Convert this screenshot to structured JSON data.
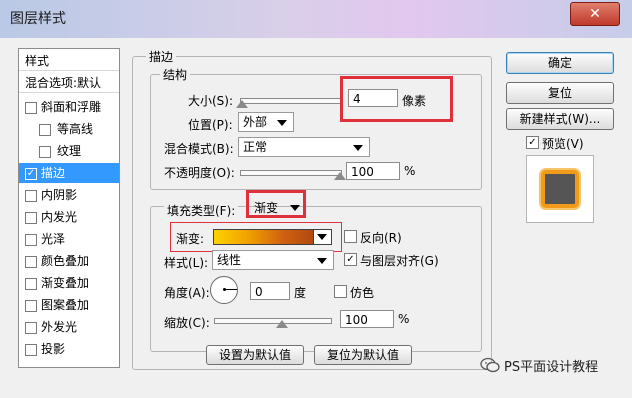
{
  "window": {
    "title": "图层样式",
    "close_glyph": "✕"
  },
  "styles_list": {
    "header": "样式",
    "items": [
      {
        "label": "混合选项:默认",
        "has_checkbox": false,
        "checked": false,
        "selected": false
      },
      {
        "label": "斜面和浮雕",
        "has_checkbox": true,
        "checked": false,
        "selected": false
      },
      {
        "label": "等高线",
        "has_checkbox": true,
        "checked": false,
        "selected": false
      },
      {
        "label": "纹理",
        "has_checkbox": true,
        "checked": false,
        "selected": false
      },
      {
        "label": "描边",
        "has_checkbox": true,
        "checked": true,
        "selected": true
      },
      {
        "label": "内阴影",
        "has_checkbox": true,
        "checked": false,
        "selected": false
      },
      {
        "label": "内发光",
        "has_checkbox": true,
        "checked": false,
        "selected": false
      },
      {
        "label": "光泽",
        "has_checkbox": true,
        "checked": false,
        "selected": false
      },
      {
        "label": "颜色叠加",
        "has_checkbox": true,
        "checked": false,
        "selected": false
      },
      {
        "label": "渐变叠加",
        "has_checkbox": true,
        "checked": false,
        "selected": false
      },
      {
        "label": "图案叠加",
        "has_checkbox": true,
        "checked": false,
        "selected": false
      },
      {
        "label": "外发光",
        "has_checkbox": true,
        "checked": false,
        "selected": false
      },
      {
        "label": "投影",
        "has_checkbox": true,
        "checked": false,
        "selected": false
      }
    ]
  },
  "stroke": {
    "section_title": "描边",
    "structure_title": "结构",
    "size_label": "大小(S):",
    "size_value": "4",
    "size_unit": "像素",
    "position_label": "位置(P):",
    "position_value": "外部",
    "blend_label": "混合模式(B):",
    "blend_value": "正常",
    "opacity_label": "不透明度(O):",
    "opacity_value": "100",
    "opacity_unit": "%",
    "fill_type_label": "填充类型(F):",
    "fill_type_value": "渐变",
    "gradient_label": "渐变:",
    "reverse_label": "反向(R)",
    "style_label": "样式(L):",
    "style_value": "线性",
    "align_label": "与图层对齐(G)",
    "angle_label": "角度(A):",
    "angle_value": "0",
    "angle_unit": "度",
    "dither_label": "仿色",
    "scale_label": "缩放(C):",
    "scale_value": "100",
    "scale_unit": "%",
    "set_default_button": "设置为默认值",
    "reset_default_button": "复位为默认值"
  },
  "right_panel": {
    "ok_button": "确定",
    "reset_button": "复位",
    "new_style_button": "新建样式(W)...",
    "preview_label": "预览(V)",
    "preview_checked": "✓"
  },
  "watermark": {
    "text": "PS平面设计教程"
  },
  "colors": {
    "accent_red": "#e0303a",
    "selection_blue": "#3399ff",
    "stroke_orange": "#f09a1a"
  }
}
